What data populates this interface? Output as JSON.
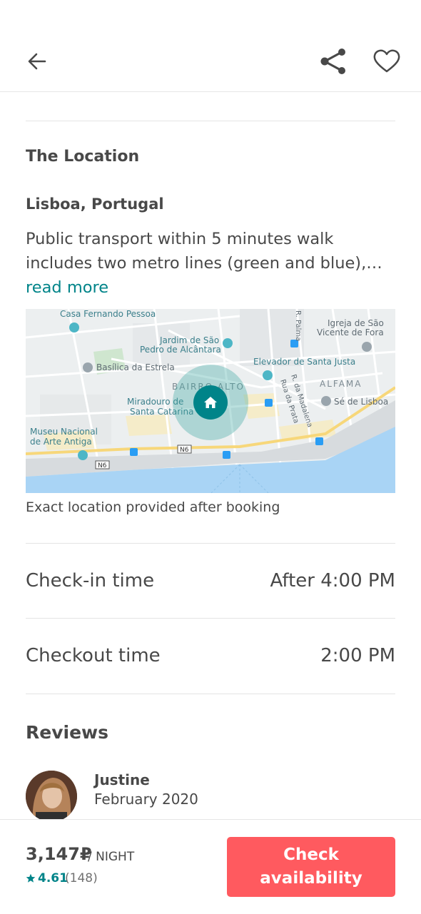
{
  "header": {
    "back_icon": "arrow-left-icon",
    "share_icon": "share-icon",
    "favorite_icon": "heart-icon"
  },
  "location": {
    "section_title": "The Location",
    "place": "Lisboa, Portugal",
    "description": "Public transport within 5 minutes walk includes two metro lines (green and blue),…",
    "read_more": "read more",
    "map_caption": "Exact location provided after booking",
    "map_labels": {
      "casa_pessoa": "Casa Fernando Pessoa",
      "jardim_1": "Jardim de São",
      "jardim_2": "Pedro de Alcântara",
      "igreja_1": "Igreja de São",
      "igreja_2": "Vicente de Fora",
      "basilica": "Basílica da Estrela",
      "elevador": "Elevador de Santa Justa",
      "bairro_alto": "BAIRRO ALTO",
      "alfama": "ALFAMA",
      "miradouro_1": "Miradouro de",
      "miradouro_2": "Santa Catarina",
      "se_lisboa": "Sé de Lisboa",
      "museu_1": "Museu Nacional",
      "museu_2": "de Arte Antiga",
      "rua_madalena": "R. da Madalena",
      "rua_prata": "Rua da Prata",
      "r_palma": "R. Palma",
      "n6_a": "N6",
      "n6_b": "N6"
    }
  },
  "details": {
    "checkin_label": "Check-in time",
    "checkin_value": "After 4:00 PM",
    "checkout_label": "Checkout time",
    "checkout_value": "2:00 PM"
  },
  "reviews": {
    "title": "Reviews",
    "items": [
      {
        "name": "Justine",
        "date": "February 2020"
      }
    ]
  },
  "footer": {
    "price": "3,147₽",
    "per_night": "/ NIGHT",
    "rating": "4.61",
    "rating_count": "(148)",
    "cta": "Check availability"
  },
  "colors": {
    "accent": "#008489",
    "cta": "#FF5A5F",
    "text": "#484848",
    "water": "#A9D4F5"
  }
}
